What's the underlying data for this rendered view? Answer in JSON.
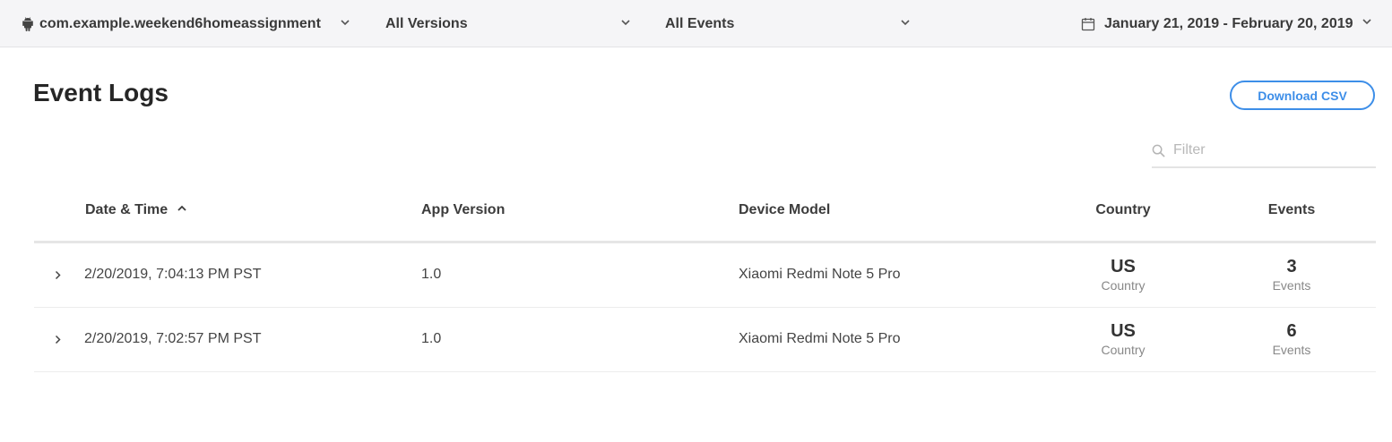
{
  "topbar": {
    "app_name": "com.example.weekend6homeassignment",
    "versions": "All Versions",
    "events": "All Events",
    "date_range": "January 21, 2019 - February 20, 2019"
  },
  "page": {
    "title": "Event Logs",
    "download_label": "Download CSV",
    "filter_placeholder": "Filter"
  },
  "table": {
    "headers": {
      "datetime": "Date & Time",
      "app_version": "App Version",
      "device_model": "Device Model",
      "country": "Country",
      "events": "Events"
    },
    "rows": [
      {
        "datetime": "2/20/2019, 7:04:13 PM PST",
        "app_version": "1.0",
        "device_model": "Xiaomi Redmi Note 5 Pro",
        "country": "US",
        "country_label": "Country",
        "events": "3",
        "events_label": "Events"
      },
      {
        "datetime": "2/20/2019, 7:02:57 PM PST",
        "app_version": "1.0",
        "device_model": "Xiaomi Redmi Note 5 Pro",
        "country": "US",
        "country_label": "Country",
        "events": "6",
        "events_label": "Events"
      }
    ]
  },
  "colors": {
    "accent": "#3d8ee8",
    "topbar_bg": "#f5f5f7"
  }
}
